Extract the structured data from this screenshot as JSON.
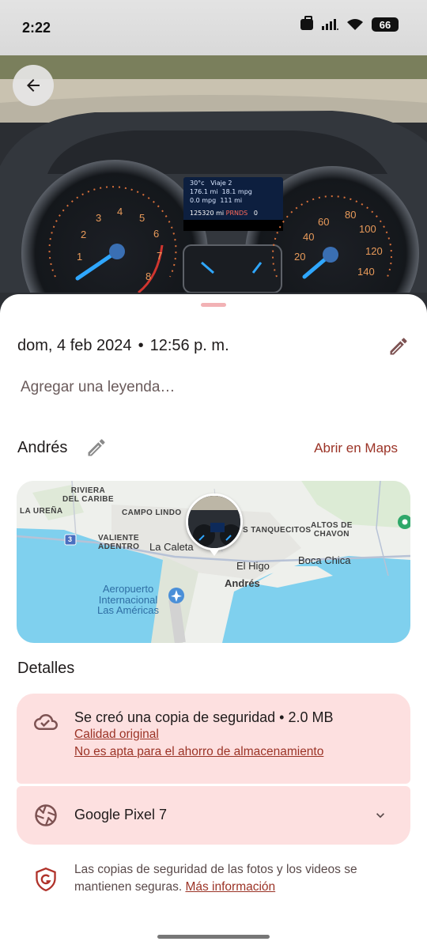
{
  "status_bar": {
    "time": "2:22",
    "battery": "66"
  },
  "photo": {
    "dashboard": {
      "temp": "30°c",
      "trip": "Viaje 2",
      "dist1": "176.1 mi",
      "mpg1": "18.1 mpg",
      "mpg2": "0.0 mpg",
      "dist2": "111 mi",
      "odometer": "125320 mi",
      "gear": "PRNDS",
      "gear_val": "0",
      "tach_numbers": [
        "1",
        "2",
        "3",
        "4",
        "5",
        "6",
        "7",
        "8"
      ],
      "speed_numbers": [
        "20",
        "40",
        "60",
        "80",
        "100",
        "120",
        "140"
      ]
    }
  },
  "info": {
    "date": "dom, 4 feb 2024",
    "separator": "•",
    "time": "12:56 p. m.",
    "caption_placeholder": "Agregar una leyenda…"
  },
  "location": {
    "name": "Andrés",
    "open_maps": "Abrir en Maps"
  },
  "map": {
    "labels": {
      "riviera": "RIVIERA\nDEL CARIBE",
      "la_urena": "LA UREÑA",
      "campo_lindo": "CAMPO LINDO",
      "tanquecitos": "S TANQUECITOS",
      "altos": "ALTOS DE\nCHAVON",
      "valiente": "VALIENTE\nADENTRO",
      "la_caleta": "La Caleta",
      "el_higo": "El Higo",
      "boca_chica": "Boca Chica",
      "andres": "Andrés",
      "airport": "Aeropuerto\nInternacional\nLas Américas",
      "route": "3"
    }
  },
  "details": {
    "title": "Detalles",
    "backup_title": "Se creó una copia de seguridad • 2.0 MB",
    "quality_link": "Calidad original",
    "storage_link": "No es apta para el ahorro de almacenamiento",
    "device": "Google Pixel 7"
  },
  "footer": {
    "safe_text": "Las copias de seguridad de las fotos y los videos se mantienen seguras.",
    "more_info": "Más información"
  },
  "colors": {
    "accent": "#9b3326",
    "card_bg": "#fde0e0",
    "handle": "#f2b2b5",
    "water": "#7fd0ee"
  }
}
